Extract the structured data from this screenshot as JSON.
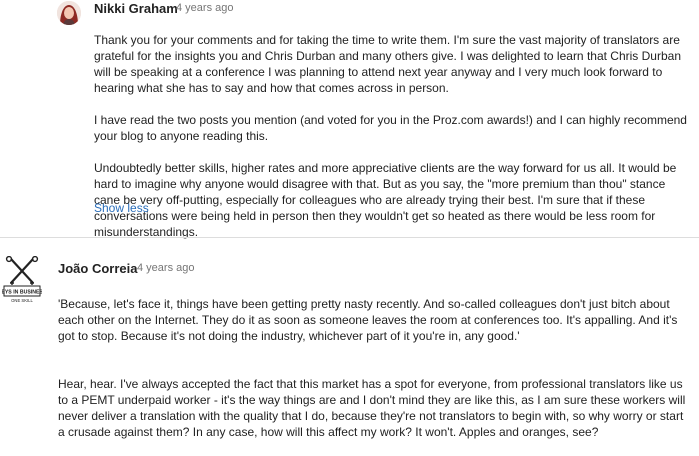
{
  "comments": [
    {
      "author": "Nikki Graham",
      "time": "4 years ago",
      "paragraphs": [
        "Thank you for your comments and for taking the time to write them. I'm sure the vast majority of translators are grateful for the insights you and Chris Durban and many others give. I was delighted to learn that Chris Durban will be speaking at a conference I was planning to attend next year anyway and I very much look forward to hearing what she has to say and how that comes across in person.",
        "I have read the two posts you mention (and voted for you in the Proz.com awards!) and I can highly recommend your blog to anyone reading this.",
        "Undoubtedly better skills, higher rates and more appreciative clients are the way forward for us all. It would be hard to imagine why anyone would disagree with that. But as you say, the \"more premium than thou\" stance cane be very off-putting, especially for colleagues who are already trying their best. I'm sure that if these conversations were being held in person then they wouldn't get so heated as there would be less room for misunderstandings."
      ],
      "toggle": "Show less"
    },
    {
      "author": "João Correia",
      "time": "4 years ago",
      "logo_text": [
        "KEYS IN BUSINESS",
        "ONE SKILL"
      ],
      "paragraphs": [
        "'Because, let's face it, things have been getting pretty nasty recently. And so-called colleagues don't just bitch about each other on the Internet. They do it as soon as someone leaves the room at conferences too. It's appalling. And it's got to stop. Because it's not doing the industry, whichever part of it you're in, any good.'",
        "Hear, hear. I've always accepted the fact that this market has a spot for everyone, from professional translators like us to a PEMT underpaid worker - it's the way things are and I don't mind they are like this, as I am sure these workers will never deliver a translation with the quality that I do, because they're not translators to begin with, so why worry or start a crusade against them? In any case, how will this affect my work? It won't. Apples and oranges, see?"
      ]
    }
  ],
  "colors": {
    "link": "#2a6ebb",
    "meta": "#767676",
    "text": "#222222"
  }
}
